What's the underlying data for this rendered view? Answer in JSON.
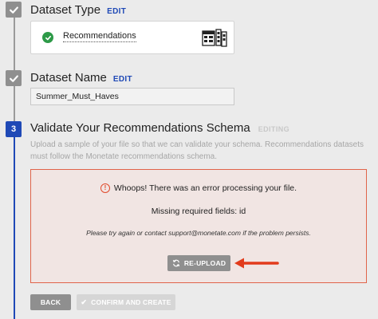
{
  "steps": [
    {
      "title": "Dataset Type",
      "edit": "EDIT"
    },
    {
      "title": "Dataset Name",
      "edit": "EDIT"
    },
    {
      "number": "3",
      "title": "Validate Your Recommendations Schema",
      "status": "EDITING"
    }
  ],
  "dataset_type": {
    "label": "Recommendations",
    "status_icon": "check-circle-icon",
    "illustration": "recommendations-illustration-icon"
  },
  "dataset_name": {
    "value": "Summer_Must_Haves"
  },
  "validate": {
    "description": "Upload a sample of your file so that we can validate your schema. Recommendations datasets must follow the Monetate recommendations schema.",
    "error": {
      "icon": "exclamation-circle-icon",
      "headline": "Whoops! There was an error processing your file.",
      "missing": "Missing required fields: id",
      "note": "Please try again or contact support@monetate.com if the problem persists.",
      "reupload_label": "RE-UPLOAD"
    }
  },
  "footer": {
    "back_label": "BACK",
    "confirm_label": "CONFIRM AND CREATE"
  },
  "colors": {
    "accent_blue": "#1f49b6",
    "error_red": "#e0644a",
    "success_green": "#2d9a48",
    "button_gray": "#8f8f8f"
  }
}
